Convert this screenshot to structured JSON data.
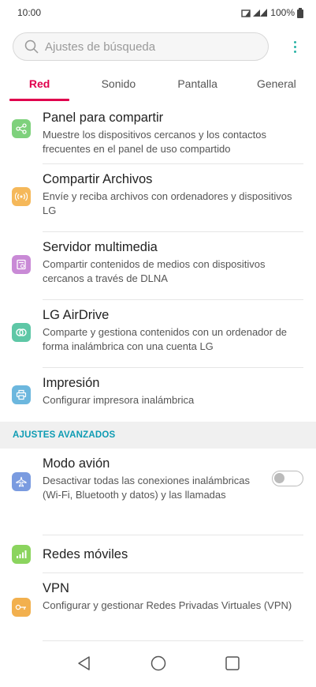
{
  "status_bar": {
    "time": "10:00",
    "battery": "100%"
  },
  "search": {
    "placeholder": "Ajustes de búsqueda"
  },
  "tabs": [
    "Red",
    "Sonido",
    "Pantalla",
    "General"
  ],
  "items": [
    {
      "title": "Panel para compartir",
      "desc": "Muestre los dispositivos cercanos y los contactos frecuentes en el panel de uso compartido",
      "icon": "share-icon",
      "color": "#7ed17c"
    },
    {
      "title": "Compartir Archivos",
      "desc": "Envíe y reciba archivos con ordenadores y dispositivos LG",
      "icon": "wireless-file-icon",
      "color": "#f5b85a"
    },
    {
      "title": "Servidor multimedia",
      "desc": "Compartir contenidos de medios con dispositivos cercanos a través de DLNA",
      "icon": "media-server-icon",
      "color": "#c98ad6"
    },
    {
      "title": "LG AirDrive",
      "desc": "Comparte y gestiona contenidos con un ordenador de forma inalámbrica con una cuenta LG",
      "icon": "airdrive-icon",
      "color": "#5ec7a6"
    },
    {
      "title": "Impresión",
      "desc": "Configurar impresora inalámbrica",
      "icon": "printer-icon",
      "color": "#6cb7de"
    }
  ],
  "advanced": {
    "header": "AJUSTES AVANZADOS",
    "items": [
      {
        "title": "Modo avión",
        "desc": "Desactivar todas las conexiones inalámbricas (Wi-Fi, Bluetooth y datos) y las llamadas",
        "icon": "airplane-icon",
        "color": "#7a9be0",
        "toggle": false
      },
      {
        "title": "Redes móviles",
        "desc": "",
        "icon": "signal-icon",
        "color": "#8bd45e"
      },
      {
        "title": "VPN",
        "desc": "Configurar y gestionar Redes Privadas Virtuales (VPN)",
        "icon": "key-icon",
        "color": "#f2b04e"
      }
    ]
  }
}
